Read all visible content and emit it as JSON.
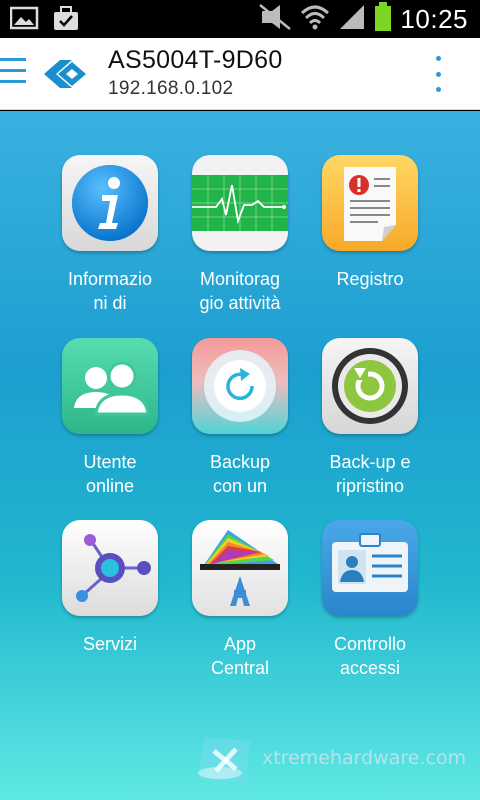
{
  "status": {
    "time": "10:25"
  },
  "appbar": {
    "title": "AS5004T-9D60",
    "subtitle": "192.168.0.102"
  },
  "tiles": [
    {
      "label1": "Informazio",
      "label2": "ni di"
    },
    {
      "label1": "Monitorag",
      "label2": "gio attività"
    },
    {
      "label1": "Registro",
      "label2": ""
    },
    {
      "label1": "Utente",
      "label2": "online"
    },
    {
      "label1": "Backup",
      "label2": "con un"
    },
    {
      "label1": "Back-up e",
      "label2": "ripristino"
    },
    {
      "label1": "Servizi",
      "label2": ""
    },
    {
      "label1": "App",
      "label2": "Central"
    },
    {
      "label1": "Controllo",
      "label2": "accessi"
    }
  ],
  "watermark": {
    "text": "xtremehardware.com"
  }
}
